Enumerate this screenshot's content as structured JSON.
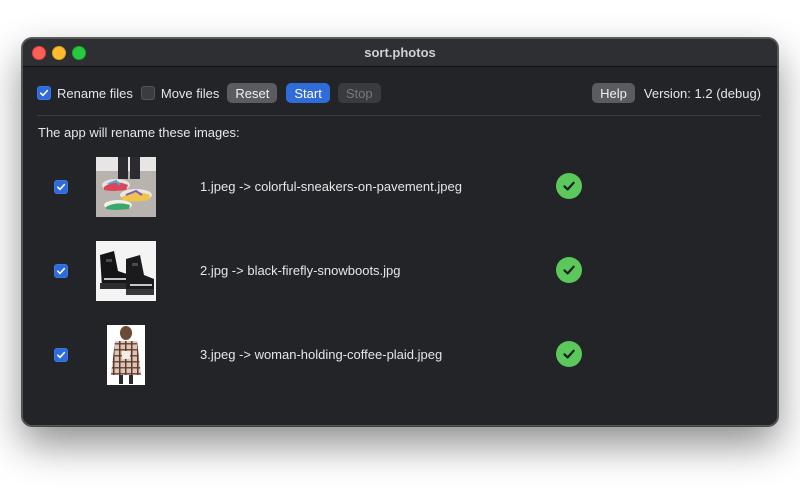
{
  "window": {
    "title": "sort.photos"
  },
  "toolbar": {
    "rename_label": "Rename files",
    "rename_checked": true,
    "move_label": "Move files",
    "move_checked": false,
    "reset_label": "Reset",
    "start_label": "Start",
    "stop_label": "Stop",
    "help_label": "Help",
    "version_text": "Version: 1.2  (debug)"
  },
  "intro_text": "The app will rename these images:",
  "files": [
    {
      "checked": true,
      "rename": "1.jpeg -> colorful-sneakers-on-pavement.jpeg",
      "status_icon": "check-circle-icon"
    },
    {
      "checked": true,
      "rename": "2.jpg -> black-firefly-snowboots.jpg",
      "status_icon": "check-circle-icon"
    },
    {
      "checked": true,
      "rename": "3.jpeg -> woman-holding-coffee-plaid.jpeg",
      "status_icon": "check-circle-icon"
    }
  ],
  "colors": {
    "accent": "#2f6bd9",
    "success": "#5ac85a",
    "window_bg": "#232427",
    "close": "#fe5f57",
    "minimize": "#febc2e",
    "maximize": "#28c840"
  }
}
